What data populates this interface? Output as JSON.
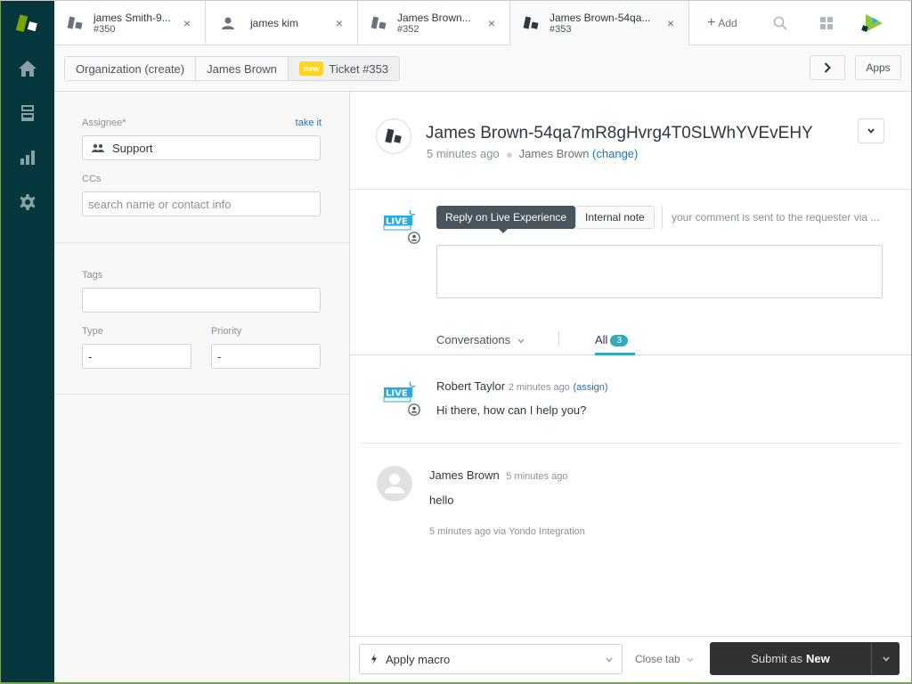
{
  "tabs": [
    {
      "title": "james Smith-9...",
      "sub": "#350",
      "icon": "ticket-icon"
    },
    {
      "title": "james kim",
      "sub": "",
      "icon": "user-icon"
    },
    {
      "title": "James Brown...",
      "sub": "#352",
      "icon": "ticket-icon"
    },
    {
      "title": "James Brown-54qa...",
      "sub": "#353",
      "icon": "ticket-icon",
      "active": true
    }
  ],
  "topbar": {
    "add_label": "Add",
    "close_glyph": "×",
    "plus_glyph": "+"
  },
  "breadcrumb": {
    "items": [
      "Organization (create)",
      "James Brown",
      "Ticket #353"
    ],
    "status_badge": "new"
  },
  "crumbbar": {
    "apps_label": "Apps"
  },
  "properties": {
    "assignee_label": "Assignee*",
    "take_it_label": "take it",
    "assignee_value": "Support",
    "ccs_label": "CCs",
    "ccs_placeholder": "search name or contact info",
    "tags_label": "Tags",
    "tags_value": "",
    "type_label": "Type",
    "type_value": "-",
    "priority_label": "Priority",
    "priority_value": "-"
  },
  "ticket": {
    "title": "James Brown-54qa7mR8gHvrg4T0SLWhYVEvEHY",
    "created": "5 minutes ago",
    "requester": "James Brown",
    "change_label": "(change)"
  },
  "composer": {
    "reply_label": "Reply on Live Experience",
    "internal_note_label": "Internal note",
    "hint": "your comment is sent to the requester via ...",
    "body": ""
  },
  "conversation_filter": {
    "dropdown_label": "Conversations",
    "all_label": "All",
    "all_count": "3"
  },
  "events": [
    {
      "author": "Robert Taylor",
      "time": "2 minutes ago",
      "action": "(assign)",
      "body": "Hi there, how can I help you?",
      "avatar": "live-experience-logo"
    },
    {
      "author": "James Brown",
      "time": "5 minutes ago",
      "body": "hello",
      "via": "5 minutes ago via Yondo Integration",
      "avatar": "default-user-avatar"
    }
  ],
  "footer": {
    "macro_label": "Apply macro",
    "close_tab_label": "Close tab",
    "submit_prefix": "Submit as",
    "submit_status": "New"
  },
  "colors": {
    "nav_bg": "#03363d",
    "accent": "#30aabc",
    "link": "#1f73b7",
    "new_badge": "#ffd424",
    "submit_bg": "#2f3133",
    "brand_green": "#78a300"
  }
}
